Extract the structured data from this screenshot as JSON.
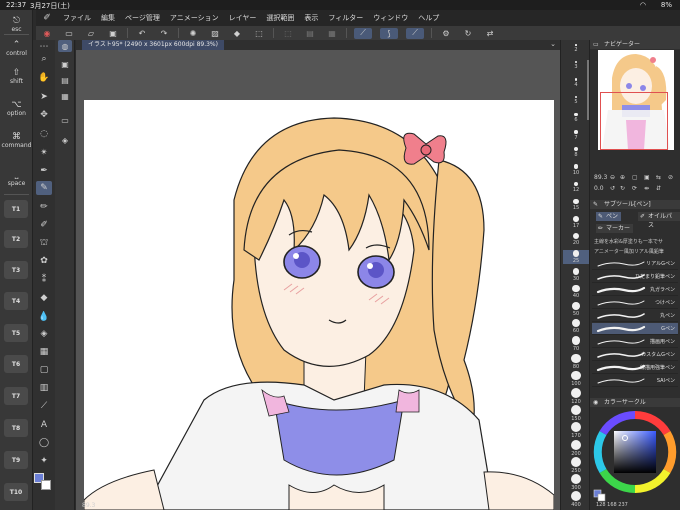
{
  "status": {
    "time": "22:37",
    "date": "3月27日(土)",
    "battery": "8%"
  },
  "menu": [
    "ファイル",
    "編集",
    "ページ管理",
    "アニメーション",
    "レイヤー",
    "選択範囲",
    "表示",
    "フィルター",
    "ウィンドウ",
    "ヘルプ"
  ],
  "command_bar": {
    "esc": "esc",
    "control": "control",
    "shift": "shift",
    "option": "option",
    "command": "command",
    "space": "space",
    "tkeys": [
      "T1",
      "T2",
      "T3",
      "T4",
      "T5",
      "T6",
      "T7",
      "T8",
      "T9",
      "T10"
    ]
  },
  "canvas": {
    "tab_label": "イラスト95* (2490 x 3601px 600dpi 89.3%)",
    "zoom": "89.3"
  },
  "brush_sizes": [
    "2",
    "3",
    "4",
    "5",
    "6",
    "7",
    "8",
    "10",
    "12",
    "15",
    "17",
    "20",
    "25",
    "30",
    "40",
    "50",
    "60",
    "70",
    "80",
    "100",
    "120",
    "150",
    "170",
    "200",
    "250",
    "300",
    "400"
  ],
  "navigator": {
    "title": "ナビゲーター",
    "zoom": "89.3",
    "angle": "0.0"
  },
  "subtool": {
    "title": "サブツール[ペン]",
    "tabs": [
      "ペン",
      "マーカー",
      "オイルパス"
    ],
    "notice": "主線を水彩&厚塗りも一本でサ",
    "notice2": "アニメーター風加リアル風鉛筆",
    "brushes": [
      "リアルGペン",
      "ひだまり鉛筆ペン",
      "丸ガラペン",
      "つけペン",
      "丸ペン",
      "Gペン",
      "描画用ペン",
      "カスタムGペン",
      "線描用強筆ペン",
      "SAIペン"
    ],
    "active_index": 5
  },
  "color": {
    "title": "カラーサークル",
    "main": "#6b7fd6",
    "hue": "128",
    "sat": "168",
    "val": "237"
  }
}
